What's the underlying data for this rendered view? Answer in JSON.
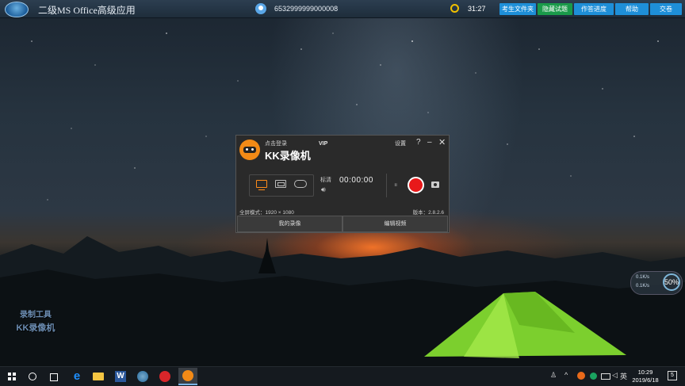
{
  "topbar": {
    "title": "二级MS Office高级应用",
    "candidate_id": "6532999999000008",
    "time_remaining": "31:27",
    "buttons": [
      {
        "label": "考生文件夹",
        "color": "#1e8fd8"
      },
      {
        "label": "隐藏试题",
        "color": "#1a9a4a"
      },
      {
        "label": "作答进度",
        "color": "#1e8fd8"
      },
      {
        "label": "帮助",
        "color": "#1e8fd8"
      },
      {
        "label": "交卷",
        "color": "#1e8fd8"
      }
    ]
  },
  "desktop_label": {
    "line1": "录制工具",
    "line2": "KK录像机"
  },
  "kk_window": {
    "login_text": "点击登录",
    "vip": "VIP",
    "app_name": "KK录像机",
    "settings": "设置",
    "help_icon": "?",
    "minimize_icon": "–",
    "close_icon": "✕",
    "quality": "标清",
    "timer": "00:00:00",
    "pause_icon": "⏸",
    "mode_label": "全屏模式：1920 × 1080",
    "version": "版本：2.8.2.6",
    "tabs": [
      "我的录像",
      "编辑视频"
    ],
    "accent": "#f28a16",
    "record_color": "#e8191a"
  },
  "network_widget": {
    "up": "0.1K/s",
    "down": "0.1K/s",
    "percent": "50%"
  },
  "taskbar": {
    "tray_icons": [
      "people-icon",
      "emoji-icon",
      "chevron-up-icon",
      "battery-icon",
      "volume-icon"
    ],
    "ime": "英",
    "time": "10:29",
    "date": "2019/6/18",
    "notifications": "5"
  }
}
